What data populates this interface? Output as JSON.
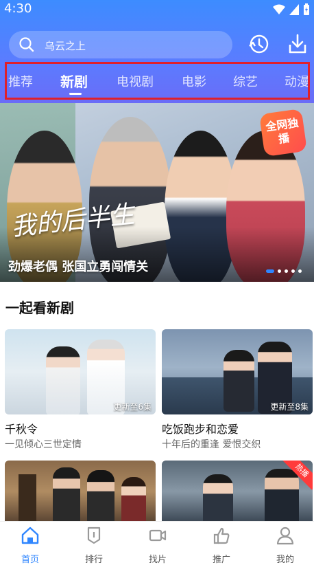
{
  "status_bar": {
    "time": "4:30"
  },
  "search": {
    "placeholder": "乌云之上"
  },
  "tabs": [
    {
      "label": "推荐"
    },
    {
      "label": "新剧"
    },
    {
      "label": "电视剧"
    },
    {
      "label": "电影"
    },
    {
      "label": "综艺"
    },
    {
      "label": "动漫"
    }
  ],
  "active_tab": "新剧",
  "banner": {
    "caption": "劲爆老偶 张国立勇闯情关",
    "badge": "全网独播",
    "show_logo_text": "我的后半生",
    "carousel_dots": 5,
    "carousel_active": 1
  },
  "section": {
    "title": "一起看新剧"
  },
  "cards": [
    {
      "name": "千秋令",
      "desc": "一见倾心三世定情",
      "episode": "更新至6集"
    },
    {
      "name": "吃饭跑步和恋爱",
      "desc": "十年后的重逢 爱恨交织",
      "episode": "更新至8集"
    },
    {
      "name": "",
      "desc": "",
      "episode": ""
    },
    {
      "name": "",
      "desc": "",
      "episode": "",
      "hot_label": "热播"
    }
  ],
  "bottom_nav": [
    {
      "label": "首页",
      "icon": "home-icon"
    },
    {
      "label": "排行",
      "icon": "ranking-icon"
    },
    {
      "label": "找片",
      "icon": "video-camera-icon"
    },
    {
      "label": "推广",
      "icon": "thumbs-up-icon"
    },
    {
      "label": "我的",
      "icon": "person-icon"
    }
  ],
  "colors": {
    "header_blue": "#4a85ff",
    "accent": "#2f86ff",
    "highlight_box": "#e0202a"
  }
}
